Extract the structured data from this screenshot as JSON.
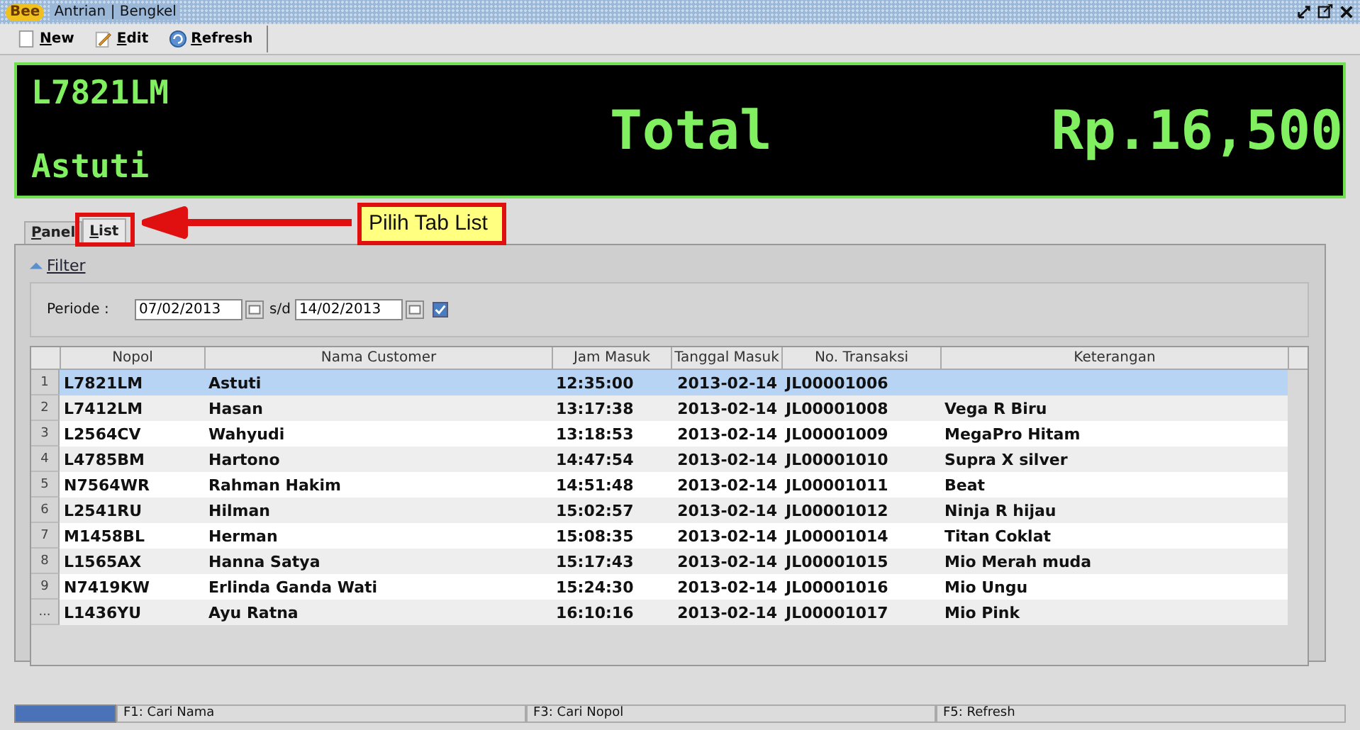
{
  "window": {
    "logo": "Bee",
    "title": "Antrian | Bengkel"
  },
  "toolbar": [
    "New",
    "Edit",
    "Refresh"
  ],
  "display": {
    "plate": "L7821LM",
    "customer": "Astuti",
    "total_label": "Total",
    "total": "Rp.16,500"
  },
  "tabs": [
    {
      "label": "Panel",
      "selected": false
    },
    {
      "label": "List",
      "selected": true
    }
  ],
  "callout": {
    "text": "Pilih Tab List"
  },
  "filter": {
    "label": "Filter",
    "expanded": true,
    "periode_label": "Periode :",
    "from": "07/02/2013",
    "separator": "s/d",
    "to": "14/02/2013",
    "checked": true
  },
  "table": {
    "columns": [
      "Nopol",
      "Nama Customer",
      "Jam Masuk",
      "Tanggal Masuk",
      "No. Transaksi",
      "Keterangan"
    ],
    "rows": [
      {
        "num": "1",
        "cells": [
          "L7821LM",
          "Astuti",
          "12:35:00",
          "2013-02-14",
          "JL00001006",
          ""
        ],
        "selected": true
      },
      {
        "num": "2",
        "cells": [
          "L7412LM",
          "Hasan",
          "13:17:38",
          "2013-02-14",
          "JL00001008",
          "Vega R Biru"
        ],
        "selected": false
      },
      {
        "num": "3",
        "cells": [
          "L2564CV",
          "Wahyudi",
          "13:18:53",
          "2013-02-14",
          "JL00001009",
          "MegaPro Hitam"
        ],
        "selected": false
      },
      {
        "num": "4",
        "cells": [
          "L4785BM",
          "Hartono",
          "14:47:54",
          "2013-02-14",
          "JL00001010",
          "Supra X silver"
        ],
        "selected": false
      },
      {
        "num": "5",
        "cells": [
          "N7564WR",
          "Rahman Hakim",
          "14:51:48",
          "2013-02-14",
          "JL00001011",
          "Beat"
        ],
        "selected": false
      },
      {
        "num": "6",
        "cells": [
          "L2541RU",
          "Hilman",
          "15:02:57",
          "2013-02-14",
          "JL00001012",
          "Ninja R hijau"
        ],
        "selected": false
      },
      {
        "num": "7",
        "cells": [
          "M1458BL",
          "Herman",
          "15:08:35",
          "2013-02-14",
          "JL00001014",
          "Titan Coklat"
        ],
        "selected": false
      },
      {
        "num": "8",
        "cells": [
          "L1565AX",
          "Hanna Satya",
          "15:17:43",
          "2013-02-14",
          "JL00001015",
          "Mio Merah muda"
        ],
        "selected": false
      },
      {
        "num": "9",
        "cells": [
          "N7419KW",
          "Erlinda Ganda Wati",
          "15:24:30",
          "2013-02-14",
          "JL00001016",
          "Mio Ungu"
        ],
        "selected": false
      },
      {
        "num": "...",
        "cells": [
          "L1436YU",
          "Ayu Ratna",
          "16:10:16",
          "2013-02-14",
          "JL00001017",
          "Mio Pink"
        ],
        "selected": false
      }
    ]
  },
  "status_bar": [
    "F1: Cari Nama",
    "F3: Cari Nopol",
    "F5: Refresh"
  ]
}
